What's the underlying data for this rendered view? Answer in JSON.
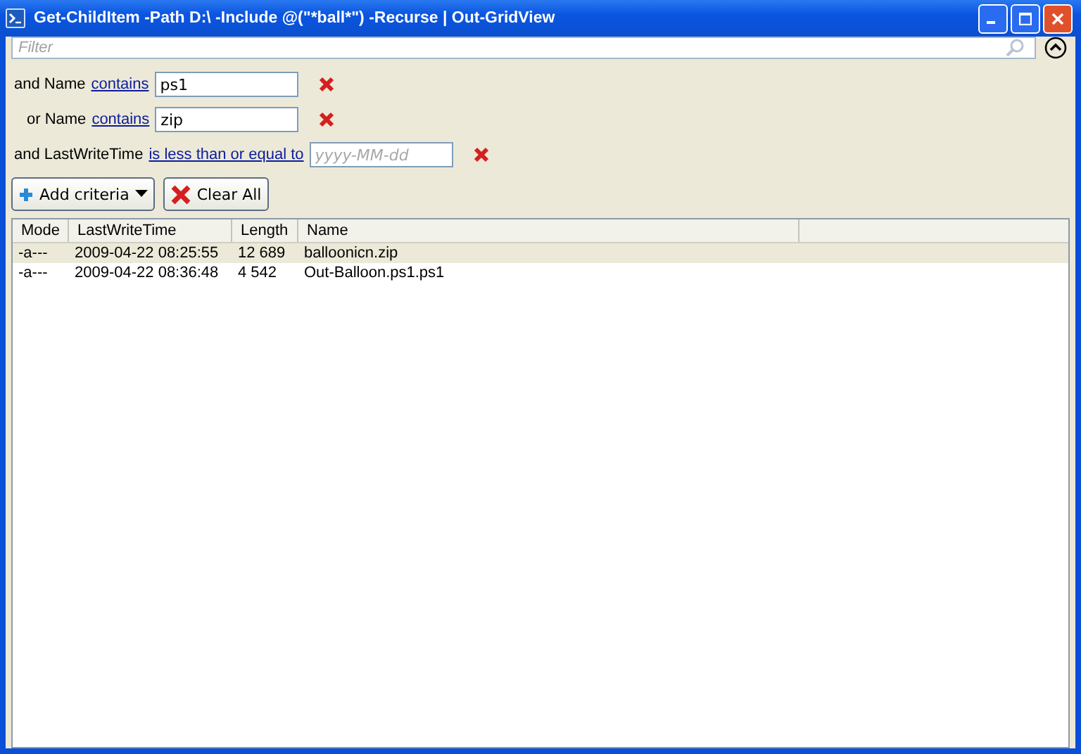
{
  "window": {
    "title": "Get-ChildItem -Path D:\\ -Include @(\"*ball*\") -Recurse | Out-GridView"
  },
  "filter": {
    "placeholder": "Filter"
  },
  "criteria": [
    {
      "prefix": "and Name",
      "operator": "contains",
      "value": "ps1"
    },
    {
      "prefix": "or Name",
      "operator": "contains",
      "value": "zip"
    },
    {
      "prefix": "and LastWriteTime",
      "operator": "is less than or equal to",
      "placeholder": "yyyy-MM-dd"
    }
  ],
  "buttons": {
    "add": "Add criteria",
    "clear": "Clear All"
  },
  "table": {
    "columns": [
      "Mode",
      "LastWriteTime",
      "Length",
      "Name"
    ],
    "rows": [
      {
        "cells": [
          "-a---",
          "2009-04-22 08:25:55",
          "12 689",
          "balloonicn.zip"
        ],
        "selected": true
      },
      {
        "cells": [
          "-a---",
          "2009-04-22 08:36:48",
          "4 542",
          "Out-Balloon.ps1.ps1"
        ],
        "selected": false
      }
    ]
  }
}
